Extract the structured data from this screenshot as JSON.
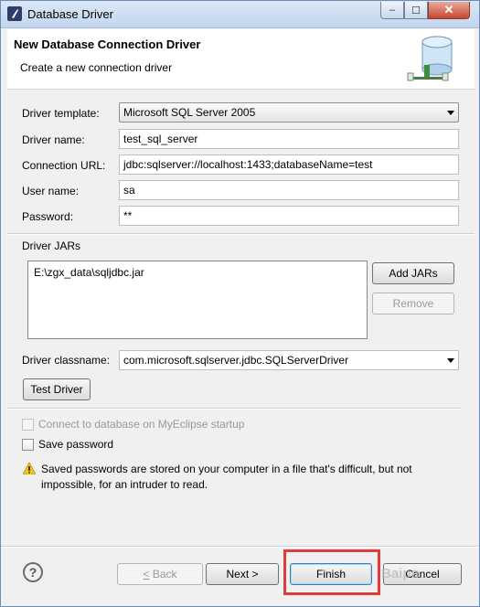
{
  "window": {
    "title": "Database Driver",
    "controls": {
      "minimize": "–",
      "maximize": "☐",
      "close": "✕"
    }
  },
  "header": {
    "title": "New Database Connection Driver",
    "subtitle": "Create a new connection driver",
    "icon": "database-icon"
  },
  "form": {
    "driver_template": {
      "label": "Driver template:",
      "value": "Microsoft SQL Server 2005"
    },
    "driver_name": {
      "label": "Driver name:",
      "value": "test_sql_server"
    },
    "connection_url": {
      "label": "Connection URL:",
      "value": "jdbc:sqlserver://localhost:1433;databaseName=test"
    },
    "user_name": {
      "label": "User name:",
      "value": "sa"
    },
    "password": {
      "label": "Password:",
      "value": "**"
    }
  },
  "jars": {
    "label": "Driver JARs",
    "items": [
      "E:\\zgx_data\\sqljdbc.jar"
    ],
    "add_button": "Add JARs",
    "remove_button": "Remove"
  },
  "classname": {
    "label": "Driver classname:",
    "value": "com.microsoft.sqlserver.jdbc.SQLServerDriver"
  },
  "test_button": "Test Driver",
  "options": {
    "connect_on_startup": {
      "label": "Connect to database on MyEclipse startup",
      "checked": false,
      "enabled": false
    },
    "save_password": {
      "label": "Save password",
      "checked": false,
      "enabled": true
    }
  },
  "warning": {
    "icon": "warning-icon",
    "text": "Saved passwords are stored on your computer in a file that's difficult, but not impossible, for an intruder to read."
  },
  "footer": {
    "help_icon": "?",
    "back_label": "< Back",
    "next_label": "Next >",
    "finish_label": "Finish",
    "cancel_label": "Cancel",
    "watermark": "Baiрв"
  },
  "colors": {
    "highlight_box": "#e23b3b",
    "title_bar": "#c2d6ee"
  }
}
